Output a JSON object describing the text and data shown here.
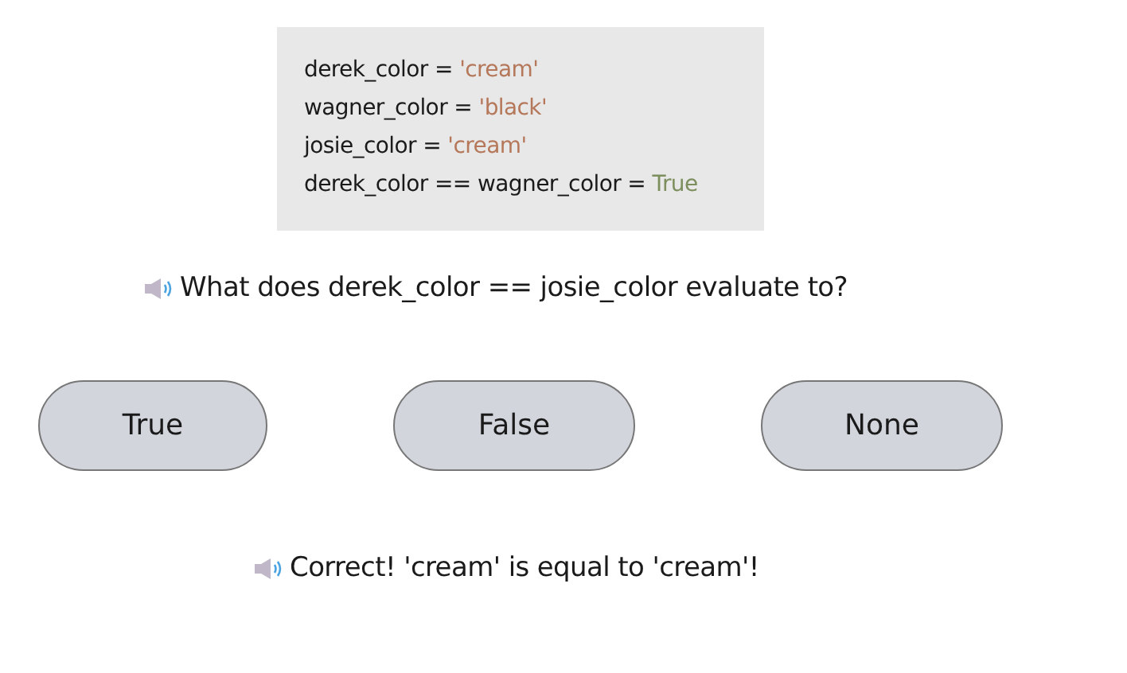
{
  "code_block": {
    "lines": [
      [
        {
          "kind": "plain",
          "text": "derek_color = "
        },
        {
          "kind": "string",
          "text": "'cream'"
        }
      ],
      [
        {
          "kind": "plain",
          "text": "wagner_color = "
        },
        {
          "kind": "string",
          "text": "'black'"
        }
      ],
      [
        {
          "kind": "plain",
          "text": "josie_color = "
        },
        {
          "kind": "string",
          "text": "'cream'"
        }
      ],
      [
        {
          "kind": "plain",
          "text": "derek_color == wagner_color = "
        },
        {
          "kind": "bool",
          "text": "True"
        }
      ]
    ]
  },
  "question": "What does derek_color == josie_color evaluate to?",
  "answers": [
    {
      "label": "True",
      "selected": false
    },
    {
      "label": "False",
      "selected": false
    },
    {
      "label": "None",
      "selected": false
    }
  ],
  "feedback": "Correct! 'cream' is equal to 'cream'!"
}
